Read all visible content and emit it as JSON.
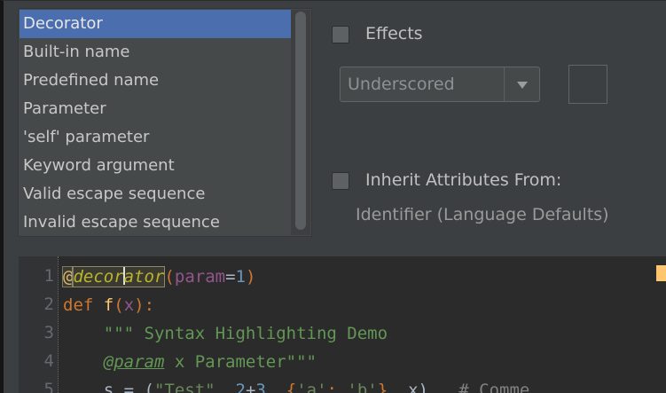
{
  "attributes_list": {
    "items": [
      {
        "label": "Decorator",
        "selected": true
      },
      {
        "label": "Built-in name",
        "selected": false
      },
      {
        "label": "Predefined name",
        "selected": false
      },
      {
        "label": "Parameter",
        "selected": false
      },
      {
        "label": "'self' parameter",
        "selected": false
      },
      {
        "label": "Keyword argument",
        "selected": false
      },
      {
        "label": "Valid escape sequence",
        "selected": false
      },
      {
        "label": "Invalid escape sequence",
        "selected": false
      }
    ]
  },
  "options": {
    "effects_label": "Effects",
    "effects_checked": false,
    "effect_type_value": "Underscored",
    "inherit_label": "Inherit Attributes From:",
    "inherit_checked": false,
    "inherit_source": "Identifier (Language Defaults)"
  },
  "preview": {
    "line_numbers": [
      "1",
      "2",
      "3",
      "4",
      "5"
    ],
    "line1": {
      "at": "@",
      "deco_a": "decor",
      "deco_b": "ator",
      "open": "(",
      "param": "param",
      "eq": "=",
      "num": "1",
      "close": ")"
    },
    "line2": {
      "kw": "def",
      "fn": "f",
      "open": "(",
      "param": "x",
      "close": "):"
    },
    "line3": {
      "indent": "    ",
      "doc": "\"\"\" Syntax Highlighting Demo"
    },
    "line4": {
      "indent": "    ",
      "tag": "@param",
      "rest": " x Parameter\"\"\""
    },
    "line5": {
      "indent": "    ",
      "lhs": "s = (",
      "str1": "\"Test\"",
      "mid1": ", ",
      "n1": "2",
      "op": "+",
      "n2": "3",
      "mid2": ", {",
      "str2": "'a'",
      "colon": ": ",
      "str3": "'b'",
      "mid3": "}, ",
      "x": "x",
      "end": ")   ",
      "comment": "# Comme"
    }
  },
  "colors": {
    "selection": "#4b6eaf",
    "panel": "#3c3f41",
    "editor_bg": "#2b2b2b",
    "keyword": "#cc7832",
    "function": "#ffc66d",
    "decorator": "#bbb529",
    "number": "#6897bb",
    "docstring": "#629755",
    "string": "#6a8759",
    "comment": "#808080",
    "parameter": "#94558d"
  }
}
